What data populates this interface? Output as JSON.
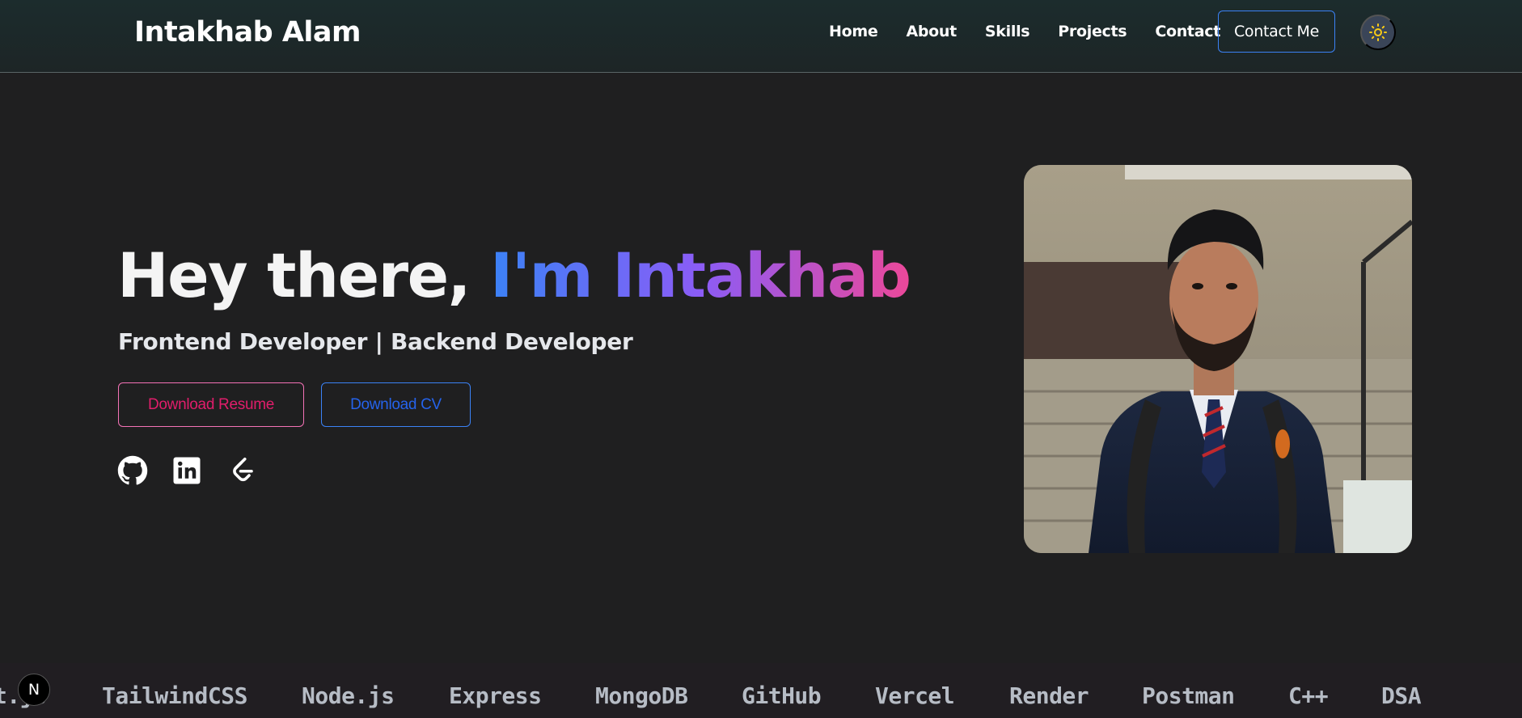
{
  "navbar": {
    "brand": "Intakhab Alam",
    "links": [
      "Home",
      "About",
      "Skills",
      "Projects",
      "Contact"
    ],
    "contact_button": "Contact Me",
    "theme_icon": "sun-icon"
  },
  "hero": {
    "title_prefix": "Hey there, ",
    "title_highlight": "I'm Intakhab",
    "subtitle": "Frontend Developer | Backend Developer",
    "resume_button": "Download Resume",
    "cv_button": "Download CV",
    "socials": [
      "github-icon",
      "linkedin-icon",
      "leetcode-icon"
    ]
  },
  "skills_marquee": [
    "t.js",
    "TailwindCSS",
    "Node.js",
    "Express",
    "MongoDB",
    "GitHub",
    "Vercel",
    "Render",
    "Postman",
    "C++",
    "DSA"
  ],
  "badge": "N",
  "colors": {
    "background": "#1f1f20",
    "accent_blue": "#3b82f6",
    "accent_purple": "#8b5cf6",
    "accent_pink": "#ec4899"
  }
}
